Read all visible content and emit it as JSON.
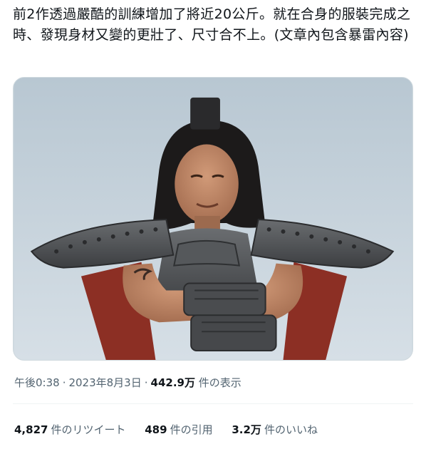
{
  "tweet": {
    "text": "前2作透過嚴酷的訓練增加了將近20公斤。就在合身的服裝完成之時、發現身材又變的更壯了、尺寸合不上。(文章內包含暴雷內容)"
  },
  "meta": {
    "time": "午後0:38",
    "separator1": "·",
    "date": "2023年8月3日",
    "separator2": "·",
    "views_count": "442.9万",
    "views_label": "件の表示"
  },
  "stats": {
    "retweets_count": "4,827",
    "retweets_label": "件のリツイート",
    "quotes_count": "489",
    "quotes_label": "件の引用",
    "likes_count": "3.2万",
    "likes_label": "件のいいね"
  }
}
